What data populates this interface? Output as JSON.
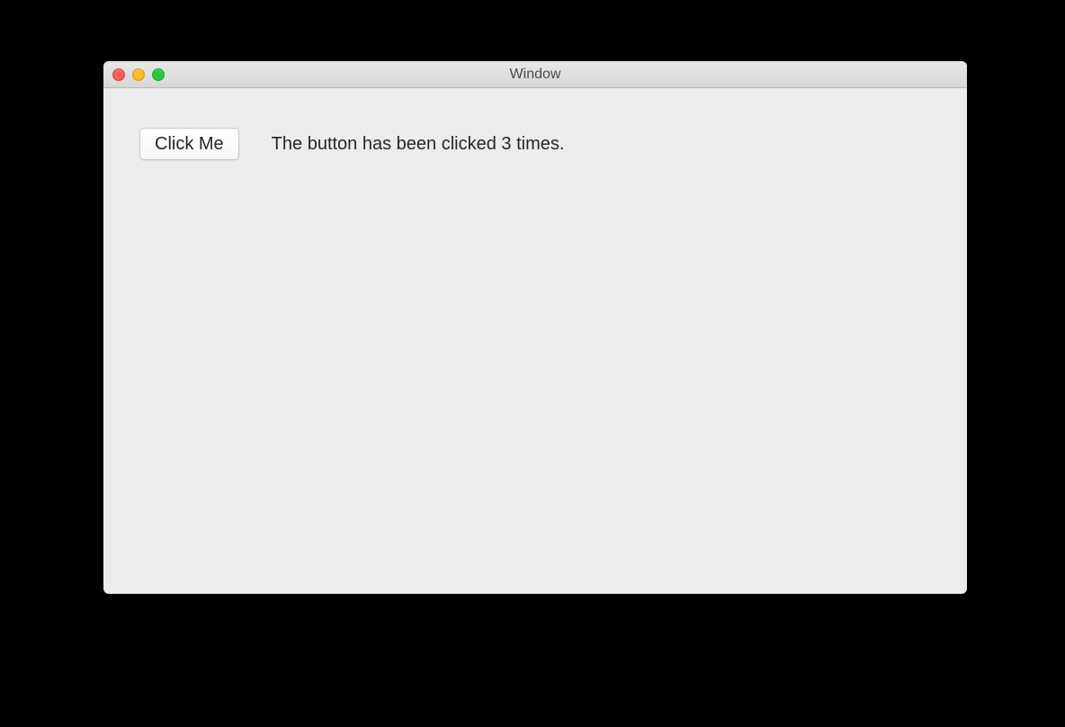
{
  "window": {
    "title": "Window"
  },
  "content": {
    "button_label": "Click Me",
    "status_text": "The button has been clicked 3 times."
  }
}
